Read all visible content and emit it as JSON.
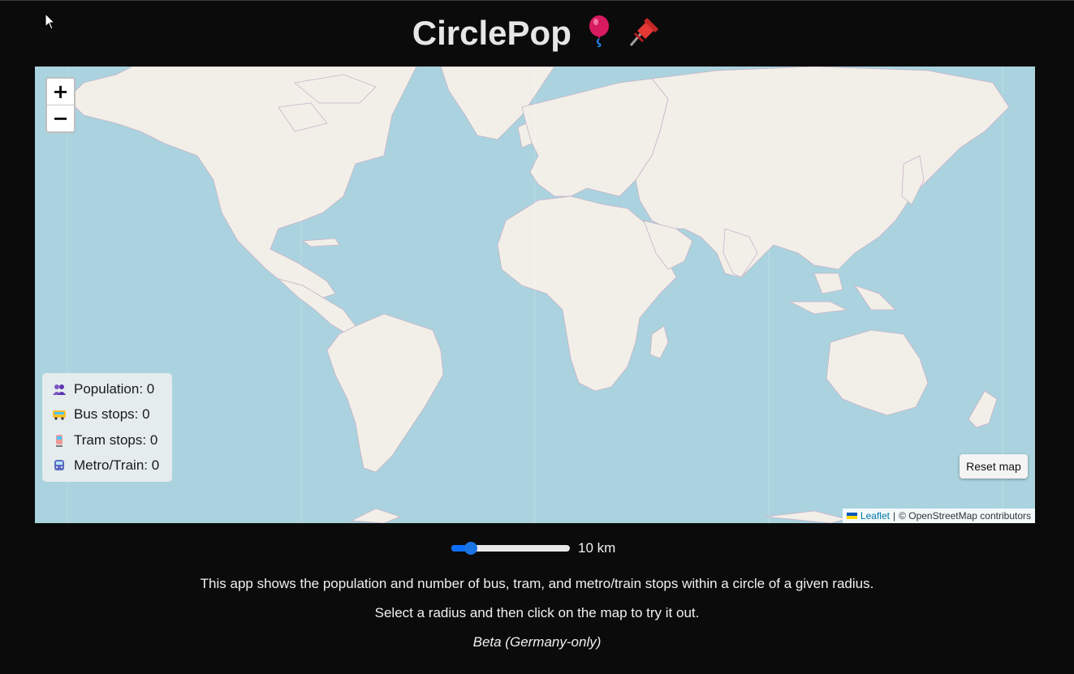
{
  "header": {
    "title": "CirclePop",
    "emojis": [
      "balloon-icon",
      "pushpin-icon"
    ]
  },
  "map": {
    "zoom_in_label": "+",
    "zoom_out_label": "−",
    "reset_label": "Reset map",
    "attribution": {
      "leaflet_link": "Leaflet",
      "separator": "|",
      "credit": "© OpenStreetMap contributors"
    },
    "colors": {
      "water": "#aad3df",
      "land": "#f2efe9",
      "border": "#c9b3c6"
    }
  },
  "stats": {
    "items": [
      {
        "icon": "people-icon",
        "label": "Population: 0"
      },
      {
        "icon": "bus-icon",
        "label": "Bus stops: 0"
      },
      {
        "icon": "tram-icon",
        "label": "Tram stops: 0"
      },
      {
        "icon": "metro-icon",
        "label": "Metro/Train: 0"
      }
    ]
  },
  "radius": {
    "value_label": "10 km",
    "value_fraction": 0.12
  },
  "info": {
    "line1": "This app shows the population and number of bus, tram, and metro/train stops within a circle of a given radius.",
    "line2": "Select a radius and then click on the map to try it out.",
    "line3": "Beta (Germany-only)"
  },
  "accent_color": "#0d6efd"
}
